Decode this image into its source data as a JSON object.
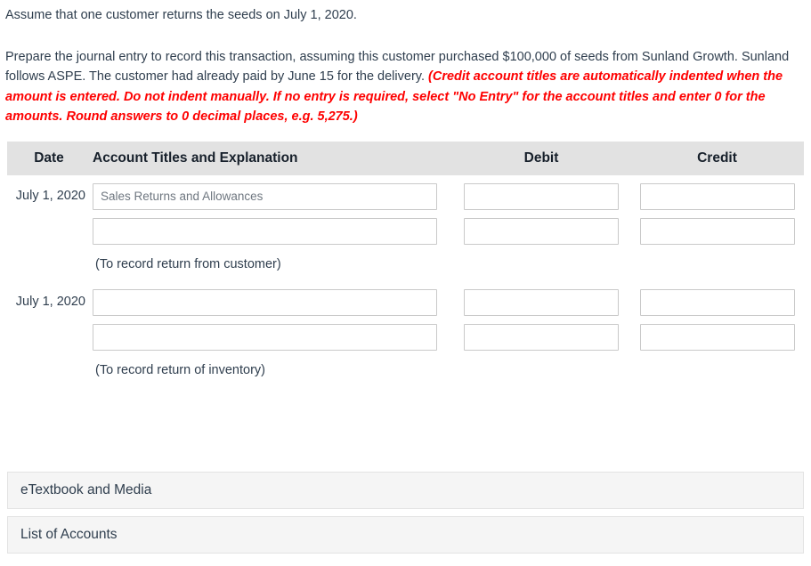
{
  "prompt": {
    "line1": "Assume that one customer returns the seeds on July 1, 2020.",
    "para2_black": "Prepare the journal entry to record this transaction, assuming this customer purchased $100,000 of seeds from Sunland Growth. Sunland follows ASPE. The customer had already paid by June 15 for the delivery. ",
    "para2_red": "(Credit account titles are automatically indented when the amount is entered. Do not indent manually. If no entry is required, select \"No Entry\" for the account titles and enter 0 for the amounts. Round answers to 0 decimal places, e.g. 5,275.)"
  },
  "table": {
    "headers": {
      "date": "Date",
      "account": "Account Titles and Explanation",
      "debit": "Debit",
      "credit": "Credit"
    },
    "blocks": [
      {
        "date": "July 1, 2020",
        "rows": [
          {
            "account": "Sales Returns and Allowances",
            "debit": "",
            "credit": ""
          },
          {
            "account": "",
            "debit": "",
            "credit": ""
          }
        ],
        "explanation": "(To record return from customer)"
      },
      {
        "date": "July 1, 2020",
        "rows": [
          {
            "account": "",
            "debit": "",
            "credit": ""
          },
          {
            "account": "",
            "debit": "",
            "credit": ""
          }
        ],
        "explanation": "(To record return of inventory)"
      }
    ]
  },
  "panels": [
    {
      "label": "eTextbook and Media"
    },
    {
      "label": "List of Accounts"
    }
  ],
  "colors": {
    "instruction_red": "#fe0000",
    "header_band": "#e2e2e2",
    "panel_bg": "#f5f5f5",
    "body_text": "#2f3e4e"
  }
}
